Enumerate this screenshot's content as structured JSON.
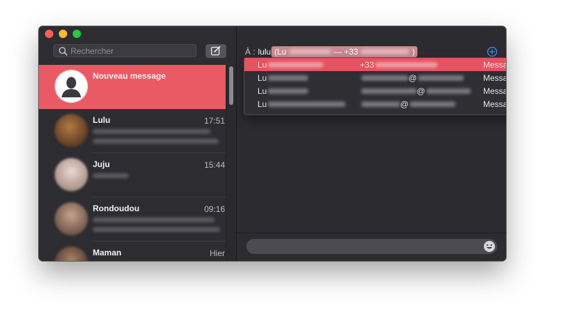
{
  "window": {
    "search_placeholder": "Rechercher"
  },
  "conversations": [
    {
      "name": "Nouveau message",
      "time": "",
      "selected": true
    },
    {
      "name": "Lulu",
      "time": "17:51"
    },
    {
      "name": "Juju",
      "time": "15:44"
    },
    {
      "name": "Rondoudou",
      "time": "09:16"
    },
    {
      "name": "Maman",
      "time": "Hier"
    }
  ],
  "compose": {
    "to_label": "À :",
    "to_text": "lulu",
    "token_prefix": "(Lu",
    "token_sep": "— +33",
    "token_suffix": ")"
  },
  "suggestions": [
    {
      "name": "Lu",
      "contact": "+33",
      "service": "Message",
      "highlight": true
    },
    {
      "name": "Lu",
      "contact": "@",
      "service": "Message"
    },
    {
      "name": "Lu",
      "contact": "@",
      "service": "Message"
    },
    {
      "name": "Lu",
      "contact": "@",
      "service": "Message"
    }
  ],
  "colors": {
    "accent": "#ea5a65",
    "sidebar": "#2d2c31",
    "main": "#2c2b30",
    "highlight_row": "#e6525f"
  },
  "icons": {
    "search": "search-icon",
    "compose": "compose-icon",
    "add": "add-contact-icon",
    "emoji": "emoji-icon",
    "avatar": "person-silhouette-icon"
  }
}
